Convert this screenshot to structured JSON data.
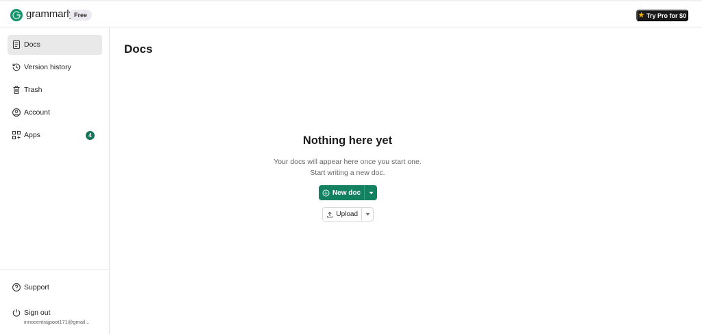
{
  "header": {
    "logo_text": "grammarly",
    "plan_badge": "Free",
    "pro_button": "Try Pro for $0",
    "brand_color": "#15946b"
  },
  "sidebar": {
    "items": [
      {
        "label": "Docs",
        "icon": "document-icon",
        "active": true
      },
      {
        "label": "Version history",
        "icon": "history-icon"
      },
      {
        "label": "Trash",
        "icon": "trash-icon"
      },
      {
        "label": "Account",
        "icon": "account-icon"
      },
      {
        "label": "Apps",
        "icon": "apps-icon",
        "badge": "4"
      }
    ],
    "bottom": {
      "support_label": "Support",
      "signout_label": "Sign out",
      "email": "innocentrajpoot171@gmail..."
    }
  },
  "main": {
    "title": "Docs",
    "empty": {
      "title": "Nothing here yet",
      "line1": "Your docs will appear here once you start one.",
      "line2": "Start writing a new doc."
    },
    "new_doc_label": "New doc",
    "upload_label": "Upload"
  },
  "colors": {
    "primary_button": "#13805f",
    "active_nav_background": "#e9e9ea",
    "badge": "#15765b"
  }
}
